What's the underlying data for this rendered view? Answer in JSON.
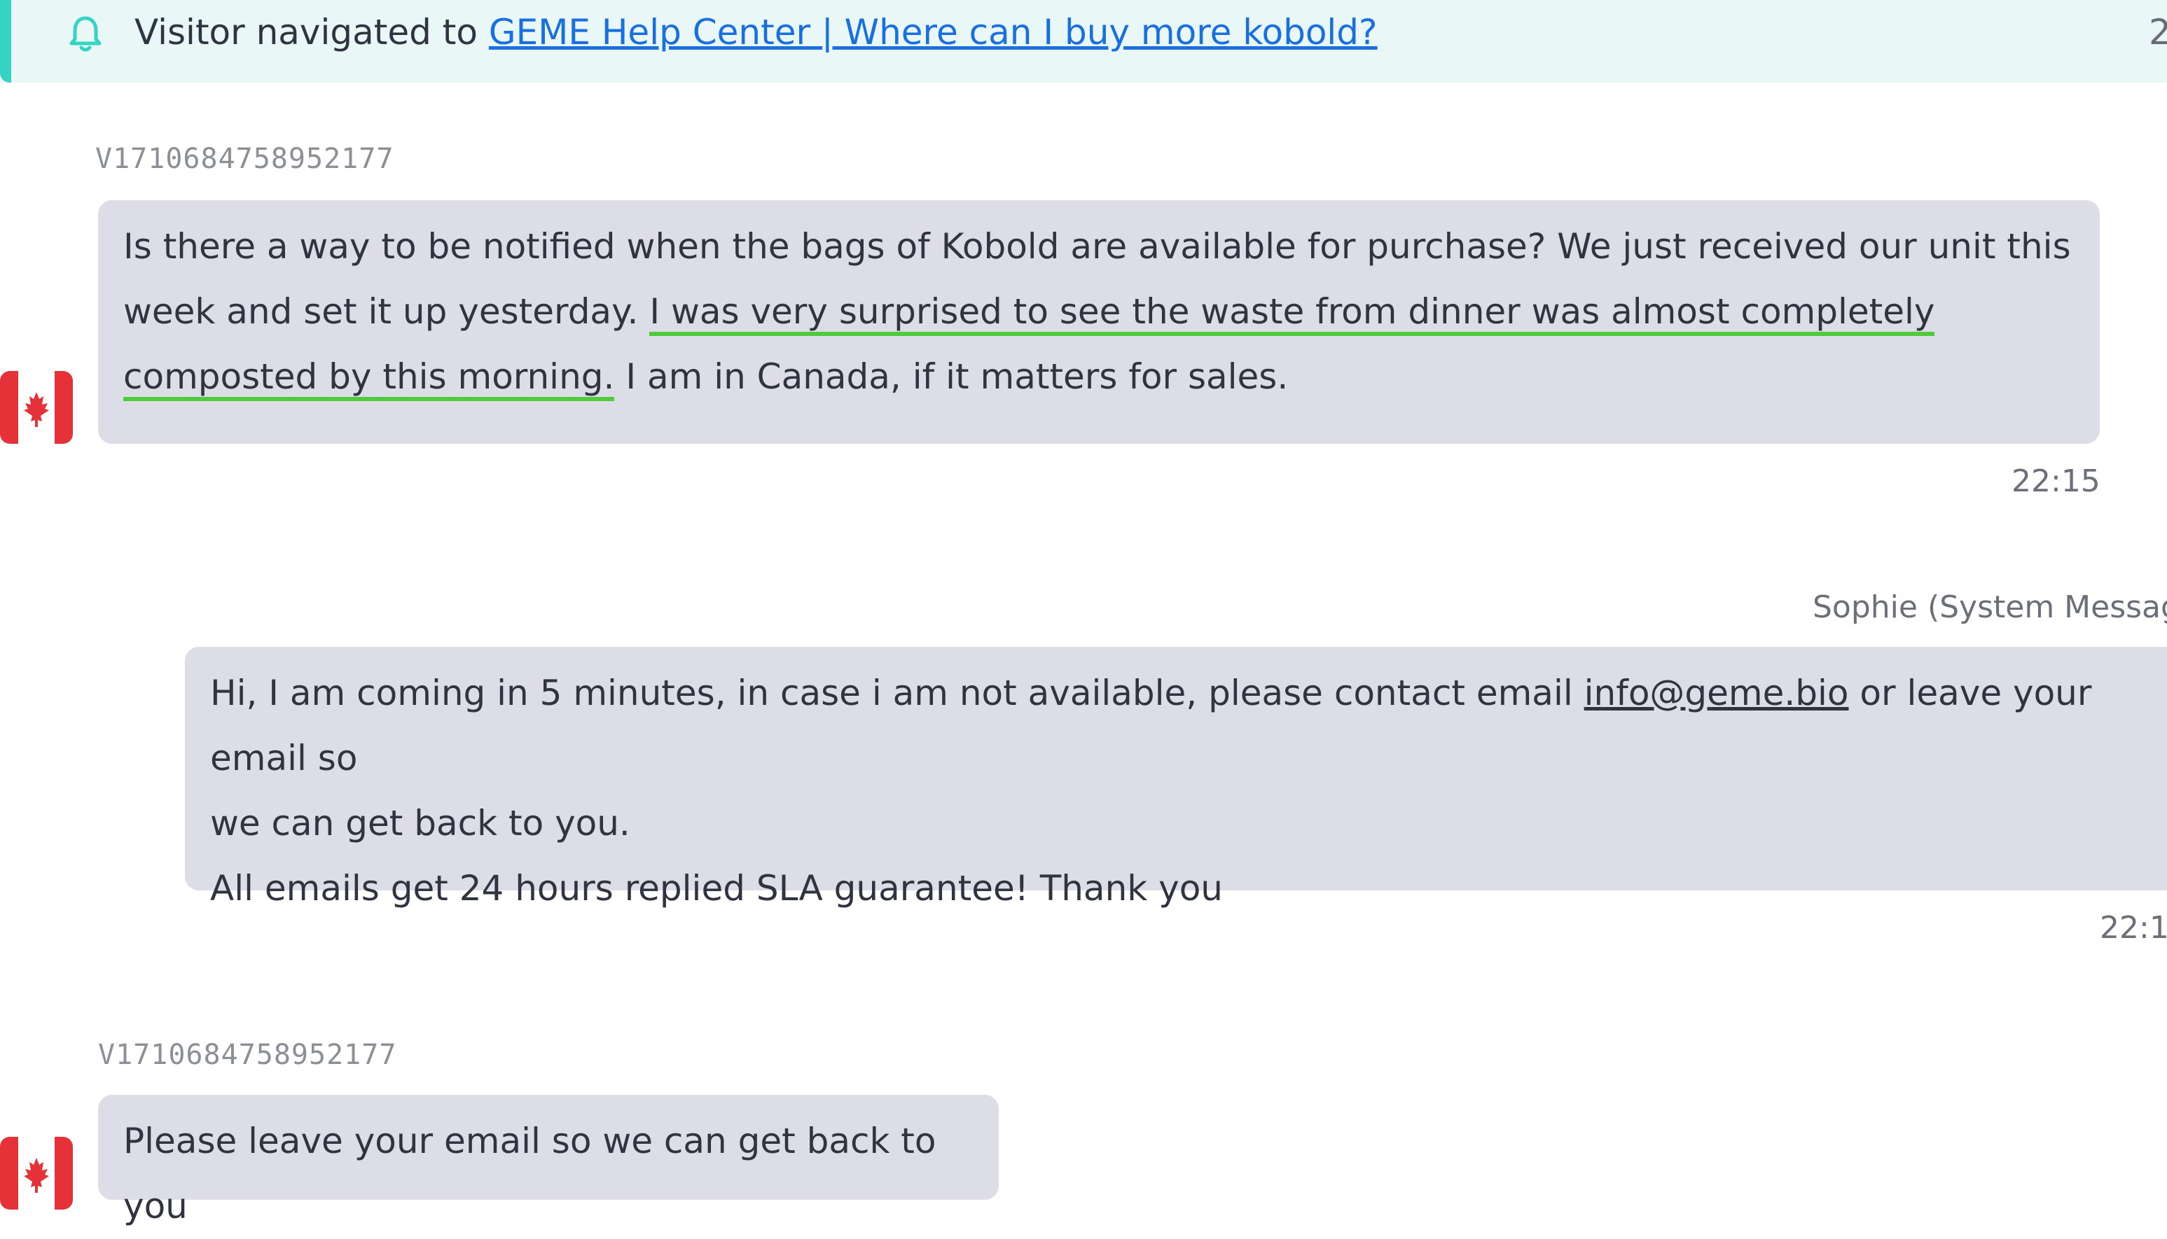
{
  "notification": {
    "text_prefix": "Visitor navigated to",
    "link_text": "GEME Help Center | Where can I buy more kobold?",
    "time_partial": "2",
    "icon": "bell-icon",
    "accent": "#35d3c3"
  },
  "messages": [
    {
      "visitor_id": "V1710684758952177",
      "flag": "canada-flag-icon",
      "text_part1": "Is there a way to be notified when the bags of Kobold are available for purchase? We just received our unit this week and set it up yesterday.",
      "highlight_line1": "I was very surprised to see the waste from dinner was almost completely",
      "highlight_line2": "composted by this morning.",
      "text_part2": "I am in Canada, if it matters for sales.",
      "time": "22:15"
    },
    {
      "sender": "Sophie (System Message",
      "text_part1": "Hi, I am coming in 5 minutes, in case i am not available, please contact email",
      "email": "info@geme.bio",
      "text_part2": "or leave your email so",
      "text_line2": "we can get back to you.",
      "text_line3": "All emails get 24 hours replied SLA guarantee! Thank you",
      "time": "22:1"
    },
    {
      "visitor_id": "V1710684758952177",
      "flag": "canada-flag-icon",
      "text": "Please leave your email so we can get back to you"
    }
  ],
  "colors": {
    "bubble": "#dcdde6",
    "highlight": "#4fcc3b",
    "link": "#1a6fe0"
  }
}
